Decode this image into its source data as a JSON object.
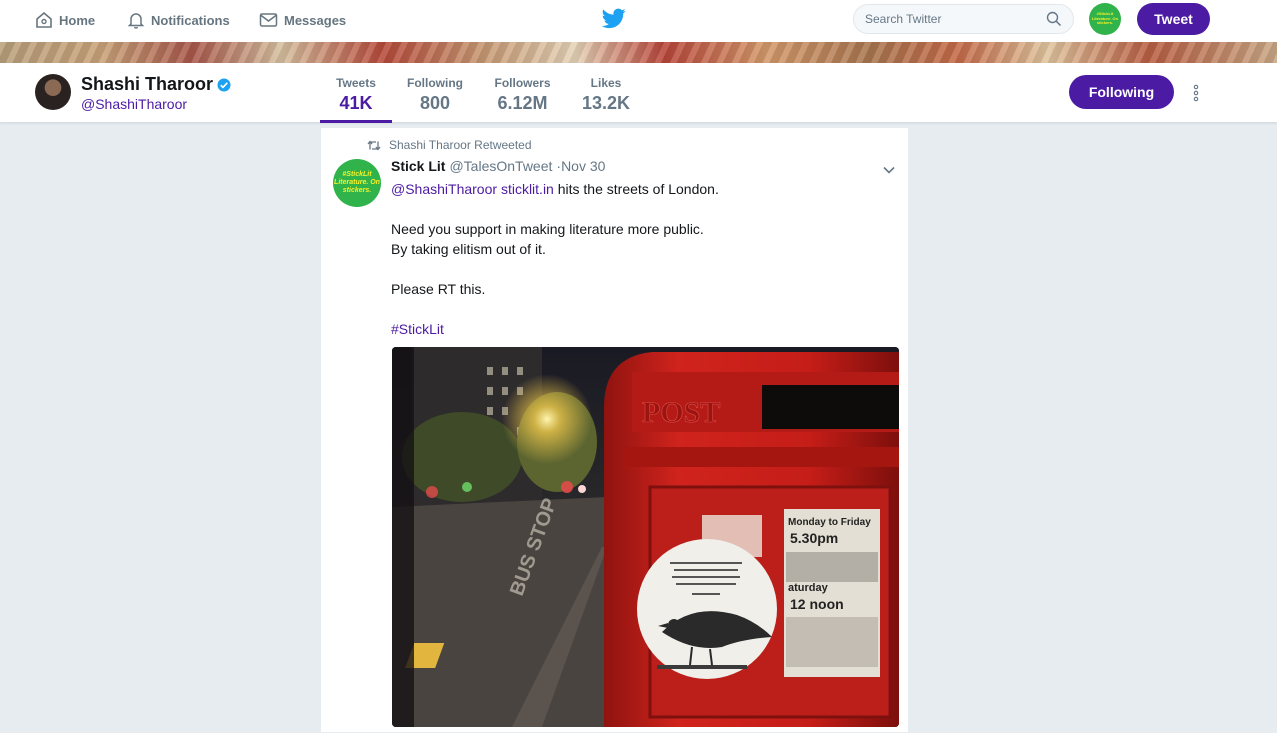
{
  "topnav": {
    "home_label": "Home",
    "notifications_label": "Notifications",
    "messages_label": "Messages",
    "search_placeholder": "Search Twitter",
    "tweet_button_label": "Tweet",
    "account_avatar_text": "#StickLit Literature. On stickers."
  },
  "profile": {
    "name": "Shashi Tharoor",
    "handle": "@ShashiTharoor",
    "verified": true,
    "stats": [
      {
        "label": "Tweets",
        "value": "41K"
      },
      {
        "label": "Following",
        "value": "800"
      },
      {
        "label": "Followers",
        "value": "6.12M"
      },
      {
        "label": "Likes",
        "value": "13.2K"
      }
    ],
    "following_button_label": "Following"
  },
  "tweet": {
    "retweeted_by": "Shashi Tharoor Retweeted",
    "author_name": "Stick Lit",
    "author_handle": "@TalesOnTweet",
    "separator": "·",
    "time": "Nov 30",
    "avatar_text": "#StickLit Literature. On stickers.",
    "mention": "@ShashiTharoor",
    "link": "sticklit.in",
    "line1_rest": " hits the streets of London.",
    "line2": "Need you support in making literature more public.",
    "line3": "By taking elitism out of it.",
    "line4": "Please RT this.",
    "hashtag": "#StickLit"
  },
  "photo": {
    "postbox_text": "POST",
    "sign_line1": "Monday to Friday",
    "sign_line2": "5.30pm",
    "sign_line3": "aturday",
    "sign_line4": "12 noon",
    "road_text": "BUS STOP"
  },
  "colors": {
    "accent": "#4b1ba3",
    "twitter_blue": "#1da1f2",
    "sticker_green": "#2fb34a",
    "postbox_red": "#d0231d"
  }
}
